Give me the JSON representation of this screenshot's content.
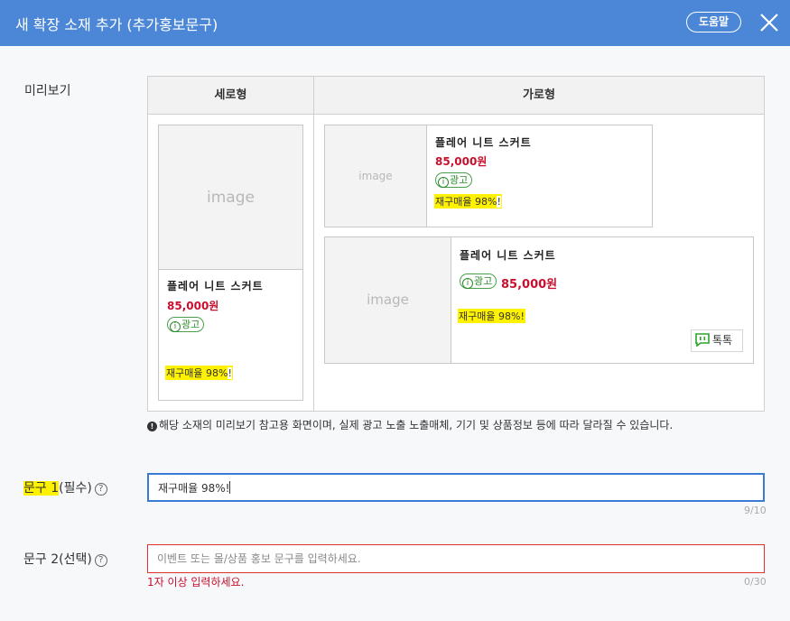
{
  "header": {
    "title": "새 확장 소재 추가 (추가홍보문구)",
    "help_label": "도움말"
  },
  "preview": {
    "label": "미리보기",
    "col_vertical": "세로형",
    "col_horizontal": "가로형",
    "image_text": "image",
    "product_name": "플레어 니트 스커트",
    "price": "85,000원",
    "ad_label": "광고",
    "ad_icon_glyph": "i",
    "highlight_text": "재구매율 98%",
    "highlight_suffix": "!",
    "talk_label": "톡톡",
    "talk_icon": "talktalk-icon",
    "highlight_color": "#fff200",
    "price_color": "#c8102e"
  },
  "notice": {
    "icon_glyph": "!",
    "text": "해당 소재의 미리보기 참고용 화면이며, 실제 광고 노출 노출매체, 기기 및 상품정보 등에 따라 달라질 수 있습니다."
  },
  "fields": {
    "phrase1": {
      "label": "문구 1",
      "label_suffix": "(필수)",
      "help_glyph": "?",
      "value": "재구매율 98%!",
      "counter": "9/10"
    },
    "phrase2": {
      "label": "문구 2(선택)",
      "help_glyph": "?",
      "placeholder": "이벤트 또는 몰/상품 홍보 문구를 입력하세요.",
      "counter": "0/30",
      "error": "1자 이상 입력하세요."
    }
  },
  "colors": {
    "header_bg": "#4b87d6",
    "focus_border": "#3a7bd5",
    "error_border": "#e03030"
  }
}
